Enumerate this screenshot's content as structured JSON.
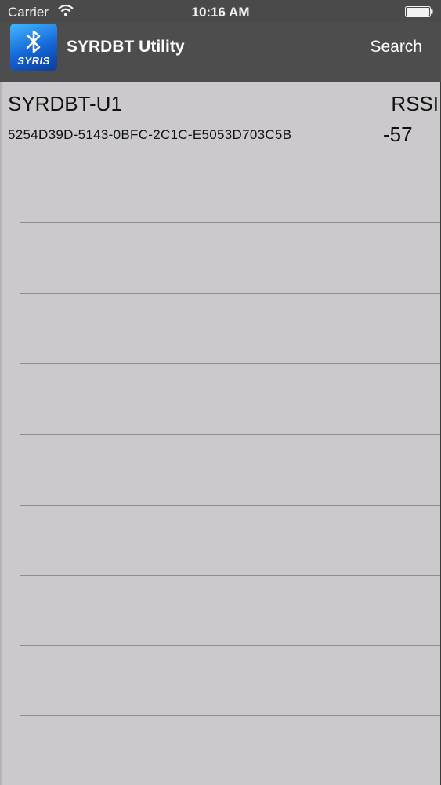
{
  "status_bar": {
    "carrier": "Carrier",
    "time": "10:16 AM"
  },
  "nav_bar": {
    "app_icon_brand": "SYRIS",
    "title": "SYRDBT Utility",
    "search_label": "Search"
  },
  "device_list": {
    "rssi_header": "RSSI",
    "devices": [
      {
        "name": "SYRDBT-U1",
        "uuid": "5254D39D-5143-0BFC-2C1C-E5053D703C5B",
        "rssi": "-57"
      }
    ]
  },
  "colors": {
    "nav_background": "#4d4d4d",
    "list_background": "#cbc9cc",
    "separator": "#8e8d91",
    "icon_blue": "#1366d6"
  }
}
